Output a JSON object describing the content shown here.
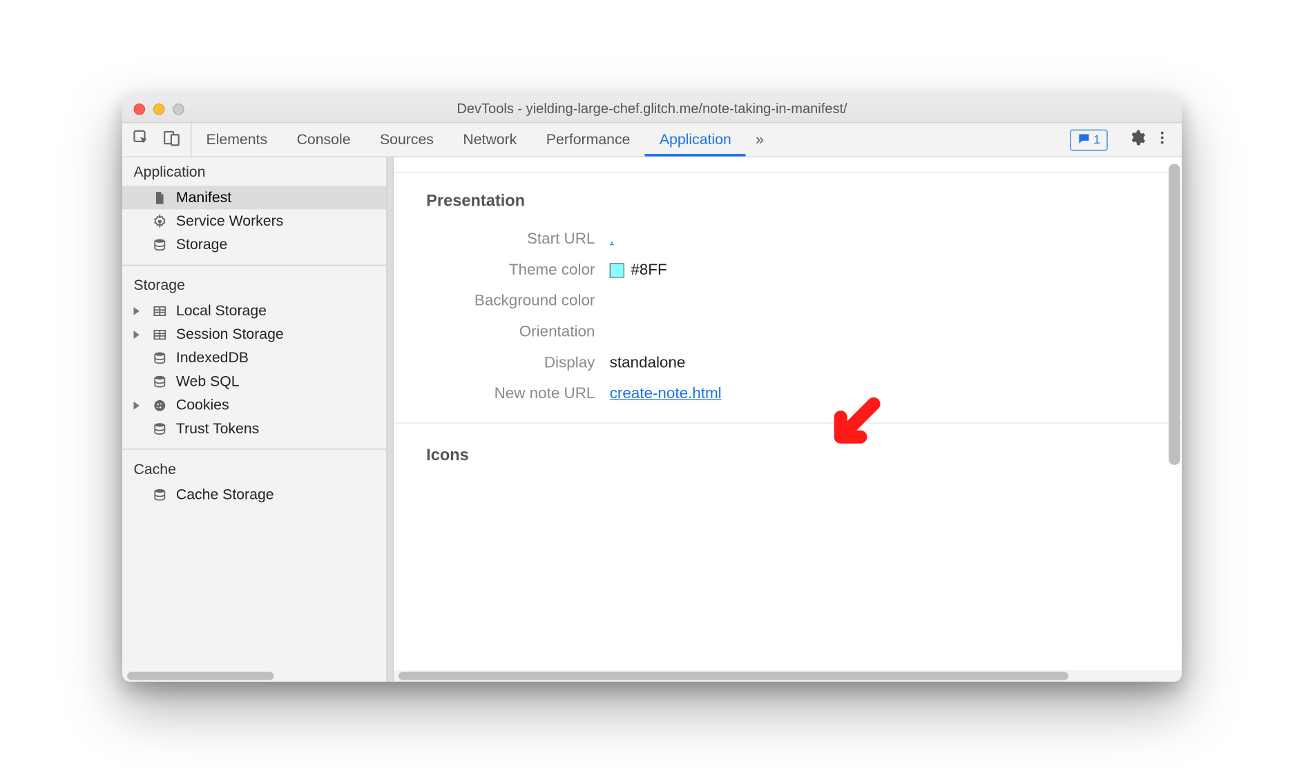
{
  "window": {
    "title": "DevTools - yielding-large-chef.glitch.me/note-taking-in-manifest/"
  },
  "tabs": {
    "items": [
      "Elements",
      "Console",
      "Sources",
      "Network",
      "Performance",
      "Application"
    ],
    "active": "Application",
    "more_glyph": "»",
    "messages_count": "1"
  },
  "sidebar": {
    "application": {
      "title": "Application",
      "items": [
        {
          "label": "Manifest",
          "icon": "file-icon",
          "selected": true
        },
        {
          "label": "Service Workers",
          "icon": "gear-icon"
        },
        {
          "label": "Storage",
          "icon": "db-icon"
        }
      ]
    },
    "storage": {
      "title": "Storage",
      "items": [
        {
          "label": "Local Storage",
          "icon": "table-icon",
          "expandable": true
        },
        {
          "label": "Session Storage",
          "icon": "table-icon",
          "expandable": true
        },
        {
          "label": "IndexedDB",
          "icon": "db-icon"
        },
        {
          "label": "Web SQL",
          "icon": "db-icon"
        },
        {
          "label": "Cookies",
          "icon": "cookie-icon",
          "expandable": true
        },
        {
          "label": "Trust Tokens",
          "icon": "db-icon"
        }
      ]
    },
    "cache": {
      "title": "Cache",
      "items": [
        {
          "label": "Cache Storage",
          "icon": "db-icon"
        }
      ]
    }
  },
  "main": {
    "section_presentation": "Presentation",
    "section_icons": "Icons",
    "rows": {
      "start_url": {
        "label": "Start URL",
        "value": "."
      },
      "theme_color": {
        "label": "Theme color",
        "value": "#8FF"
      },
      "background_color": {
        "label": "Background color",
        "value": ""
      },
      "orientation": {
        "label": "Orientation",
        "value": ""
      },
      "display": {
        "label": "Display",
        "value": "standalone"
      },
      "new_note_url": {
        "label": "New note URL",
        "value": "create-note.html"
      }
    }
  }
}
